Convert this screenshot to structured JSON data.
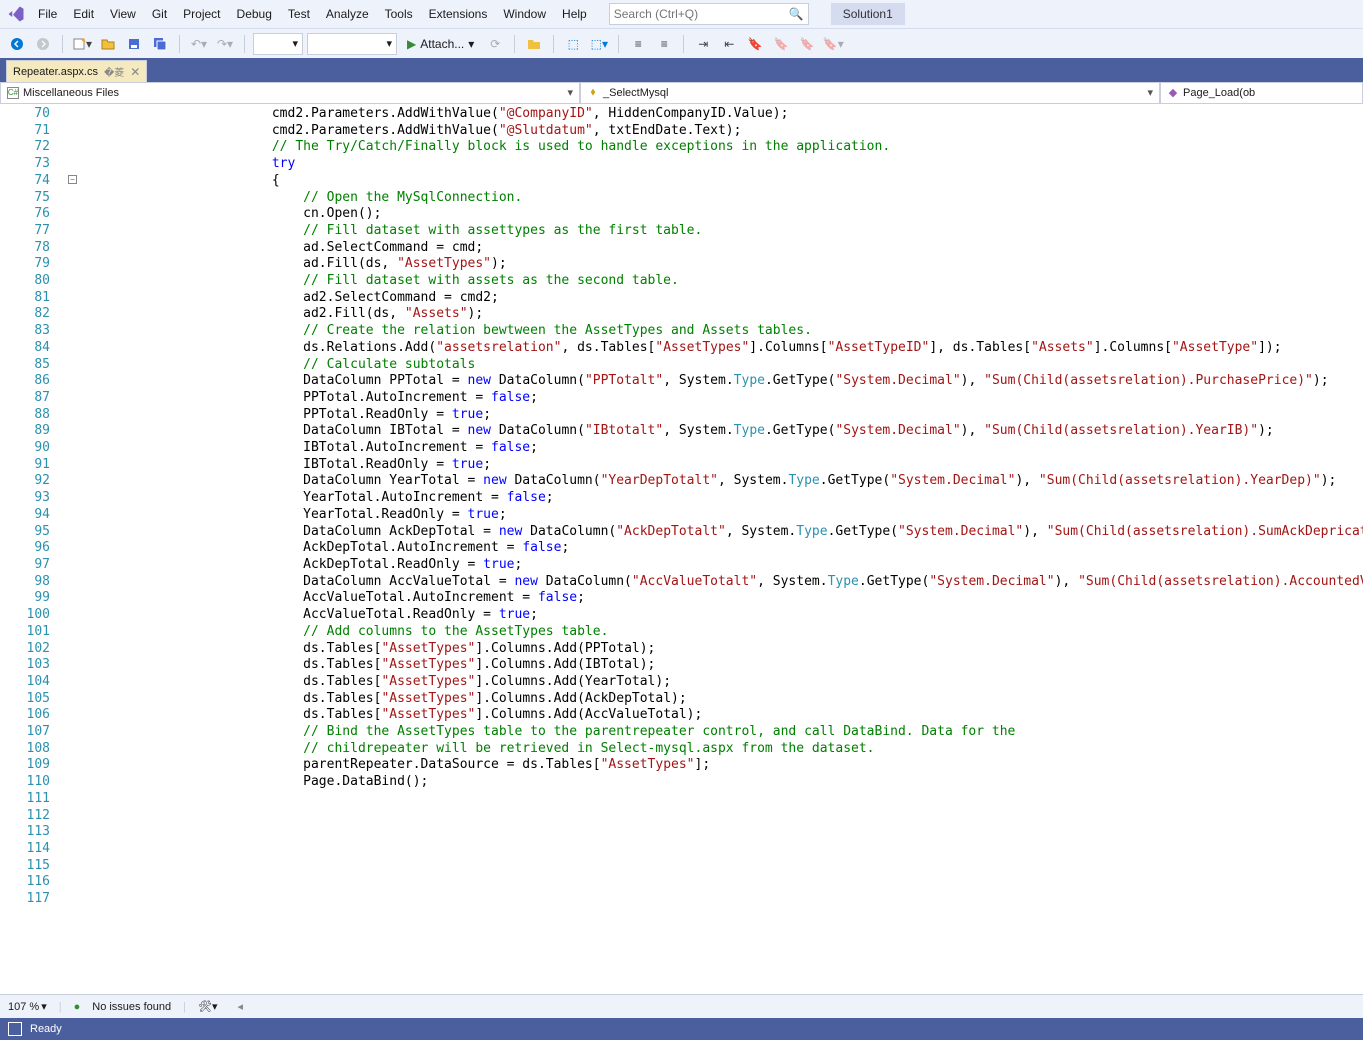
{
  "menu": {
    "items": [
      "File",
      "Edit",
      "View",
      "Git",
      "Project",
      "Debug",
      "Test",
      "Analyze",
      "Tools",
      "Extensions",
      "Window",
      "Help"
    ],
    "search_placeholder": "Search (Ctrl+Q)",
    "solution": "Solution1"
  },
  "toolbar": {
    "attach_label": "Attach..."
  },
  "tab": {
    "filename": "Repeater.aspx.cs"
  },
  "nav": {
    "left": "Miscellaneous Files",
    "middle": "_SelectMysql",
    "right": "Page_Load(ob"
  },
  "editor": {
    "first_line": 70,
    "lines": [
      {
        "i": 24,
        "t": "cmd2.Parameters.AddWithValue(",
        "s": "\"@CompanyID\"",
        "t2": ", HiddenCompanyID.Value);"
      },
      {
        "i": 24,
        "t": "cmd2.Parameters.AddWithValue(",
        "s": "\"@Slutdatum\"",
        "t2": ", txtEndDate.Text);"
      },
      {
        "i": 0,
        "t": ""
      },
      {
        "i": 24,
        "c": "// The Try/Catch/Finally block is used to handle exceptions in the application."
      },
      {
        "i": 24,
        "k": "try"
      },
      {
        "i": 24,
        "t": "{"
      },
      {
        "i": 28,
        "c": "// Open the MySqlConnection."
      },
      {
        "i": 28,
        "t": "cn.Open();"
      },
      {
        "i": 0,
        "t": ""
      },
      {
        "i": 28,
        "c": "// Fill dataset with assettypes as the first table."
      },
      {
        "i": 28,
        "t": "ad.SelectCommand = cmd;"
      },
      {
        "i": 28,
        "t": "ad.Fill(ds, ",
        "s": "\"AssetTypes\"",
        "t2": ");"
      },
      {
        "i": 0,
        "t": ""
      },
      {
        "i": 28,
        "c": "// Fill dataset with assets as the second table."
      },
      {
        "i": 28,
        "t": "ad2.SelectCommand = cmd2;"
      },
      {
        "i": 28,
        "t": "ad2.Fill(ds, ",
        "s": "\"Assets\"",
        "t2": ");"
      },
      {
        "i": 0,
        "t": ""
      },
      {
        "i": 28,
        "c": "// Create the relation bewtween the AssetTypes and Assets tables."
      },
      {
        "i": 28,
        "t": "ds.Relations.Add(",
        "s": "\"assetsrelation\"",
        "t2": ", ds.Tables[",
        "s2": "\"AssetTypes\"",
        "t3": "].Columns[",
        "s3": "\"AssetTypeID\"",
        "t4": "], ds.Tables[",
        "s4": "\"Assets\"",
        "t5": "].Columns[",
        "s5": "\"AssetType\"",
        "t6": "]);"
      },
      {
        "i": 0,
        "t": ""
      },
      {
        "i": 28,
        "c": "// Calculate subtotals"
      },
      {
        "i": 28,
        "t": "DataColumn PPTotal = ",
        "k": "new",
        "t2": " DataColumn(",
        "s": "\"PPTotalt\"",
        "t3": ", System.",
        "ty": "Type",
        "t4": ".GetType(",
        "s2": "\"System.Decimal\"",
        "t5": "), ",
        "s3": "\"Sum(Child(assetsrelation).PurchasePrice)\"",
        "t6": ");"
      },
      {
        "i": 28,
        "t": "PPTotal.AutoIncrement = ",
        "k": "false",
        "t2": ";"
      },
      {
        "i": 28,
        "t": "PPTotal.ReadOnly = ",
        "k": "true",
        "t2": ";"
      },
      {
        "i": 28,
        "t": "DataColumn IBTotal = ",
        "k": "new",
        "t2": " DataColumn(",
        "s": "\"IBtotalt\"",
        "t3": ", System.",
        "ty": "Type",
        "t4": ".GetType(",
        "s2": "\"System.Decimal\"",
        "t5": "), ",
        "s3": "\"Sum(Child(assetsrelation).YearIB)\"",
        "t6": ");"
      },
      {
        "i": 28,
        "t": "IBTotal.AutoIncrement = ",
        "k": "false",
        "t2": ";"
      },
      {
        "i": 28,
        "t": "IBTotal.ReadOnly = ",
        "k": "true",
        "t2": ";"
      },
      {
        "i": 28,
        "t": "DataColumn YearTotal = ",
        "k": "new",
        "t2": " DataColumn(",
        "s": "\"YearDepTotalt\"",
        "t3": ", System.",
        "ty": "Type",
        "t4": ".GetType(",
        "s2": "\"System.Decimal\"",
        "t5": "), ",
        "s3": "\"Sum(Child(assetsrelation).YearDep)\"",
        "t6": ");"
      },
      {
        "i": 28,
        "t": "YearTotal.AutoIncrement = ",
        "k": "false",
        "t2": ";"
      },
      {
        "i": 28,
        "t": "YearTotal.ReadOnly = ",
        "k": "true",
        "t2": ";"
      },
      {
        "i": 28,
        "t": "DataColumn AckDepTotal = ",
        "k": "new",
        "t2": " DataColumn(",
        "s": "\"AckDepTotalt\"",
        "t3": ", System.",
        "ty": "Type",
        "t4": ".GetType(",
        "s2": "\"System.Decimal\"",
        "t5": "), ",
        "s3": "\"Sum(Child(assetsrelation).SumAckDeprication)\"",
        "t6": ");"
      },
      {
        "i": 28,
        "t": "AckDepTotal.AutoIncrement = ",
        "k": "false",
        "t2": ";"
      },
      {
        "i": 28,
        "t": "AckDepTotal.ReadOnly = ",
        "k": "true",
        "t2": ";"
      },
      {
        "i": 28,
        "t": "DataColumn AccValueTotal = ",
        "k": "new",
        "t2": " DataColumn(",
        "s": "\"AccValueTotalt\"",
        "t3": ", System.",
        "ty": "Type",
        "t4": ".GetType(",
        "s2": "\"System.Decimal\"",
        "t5": "), ",
        "s3": "\"Sum(Child(assetsrelation).AccountedValue)\"",
        "t6": ");"
      },
      {
        "i": 28,
        "t": "AccValueTotal.AutoIncrement = ",
        "k": "false",
        "t2": ";"
      },
      {
        "i": 28,
        "t": "AccValueTotal.ReadOnly = ",
        "k": "true",
        "t2": ";"
      },
      {
        "i": 0,
        "t": ""
      },
      {
        "i": 28,
        "c": "// Add columns to the AssetTypes table."
      },
      {
        "i": 28,
        "t": "ds.Tables[",
        "s": "\"AssetTypes\"",
        "t2": "].Columns.Add(PPTotal);"
      },
      {
        "i": 28,
        "t": "ds.Tables[",
        "s": "\"AssetTypes\"",
        "t2": "].Columns.Add(IBTotal);"
      },
      {
        "i": 28,
        "t": "ds.Tables[",
        "s": "\"AssetTypes\"",
        "t2": "].Columns.Add(YearTotal);"
      },
      {
        "i": 28,
        "t": "ds.Tables[",
        "s": "\"AssetTypes\"",
        "t2": "].Columns.Add(AckDepTotal);"
      },
      {
        "i": 28,
        "t": "ds.Tables[",
        "s": "\"AssetTypes\"",
        "t2": "].Columns.Add(AccValueTotal);"
      },
      {
        "i": 0,
        "t": ""
      },
      {
        "i": 28,
        "c": "// Bind the AssetTypes table to the parentrepeater control, and call DataBind. Data for the"
      },
      {
        "i": 28,
        "c": "// childrepeater will be retrieved in Select-mysql.aspx from the dataset."
      },
      {
        "i": 28,
        "t": "parentRepeater.DataSource = ds.Tables[",
        "s": "\"AssetTypes\"",
        "t2": "];"
      },
      {
        "i": 28,
        "t": "Page.DataBind();"
      }
    ]
  },
  "editor_status": {
    "zoom": "107 %",
    "issues": "No issues found"
  },
  "statusbar": {
    "ready": "Ready"
  }
}
